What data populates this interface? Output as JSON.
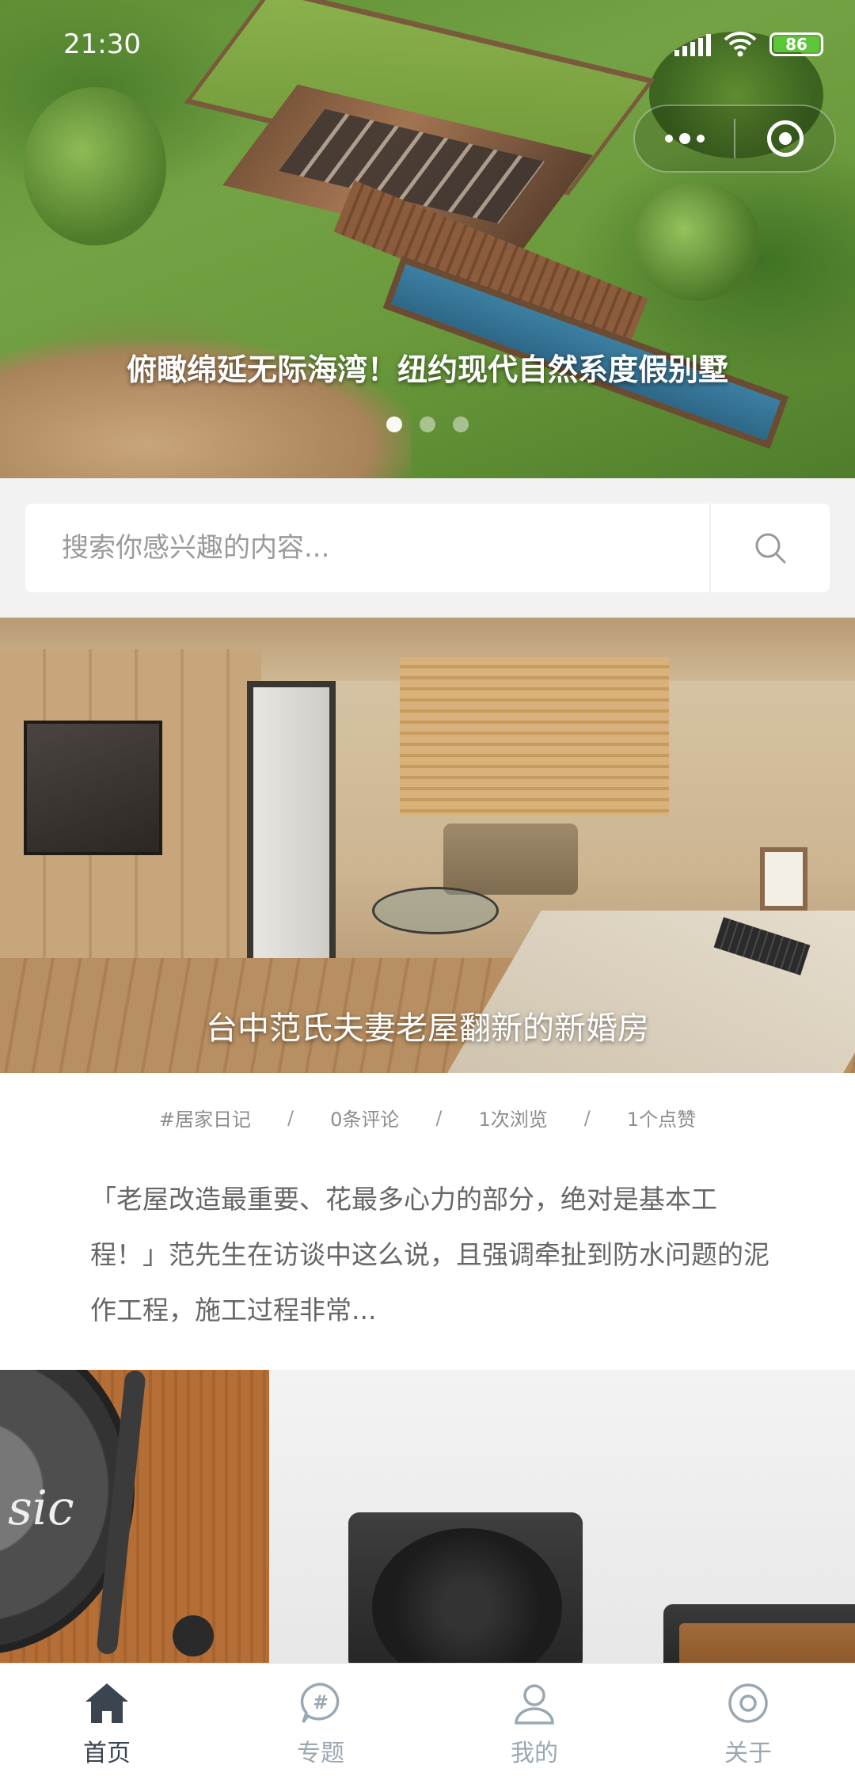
{
  "status_bar": {
    "time": "21:30",
    "battery": "86"
  },
  "hero": {
    "caption": "俯瞰绵延无际海湾！纽约现代自然系度假别墅",
    "slide_count": 3,
    "active_slide": 1
  },
  "search": {
    "placeholder": "搜索你感兴趣的内容...",
    "icon": "search-icon"
  },
  "articles": [
    {
      "title": "台中范氏夫妻老屋翻新的新婚房",
      "category": "#居家日记",
      "comments": "0条评论",
      "views": "1次浏览",
      "likes": "1个点赞",
      "excerpt": "「老屋改造最重要、花最多心力的部分，绝对是基本工程！」范先生在访谈中这么说，且强调牵扯到防水问题的泥作工程，施工过程非常..."
    },
    {
      "image_text": "sic"
    }
  ],
  "meta_separator": "/",
  "tabbar": {
    "items": [
      {
        "label": "首页",
        "icon": "home-icon",
        "active": true
      },
      {
        "label": "专题",
        "icon": "topic-icon",
        "active": false
      },
      {
        "label": "我的",
        "icon": "user-icon",
        "active": false
      },
      {
        "label": "关于",
        "icon": "about-icon",
        "active": false
      }
    ],
    "active_color": "#3a4550",
    "inactive_color": "#9aa8b4"
  }
}
